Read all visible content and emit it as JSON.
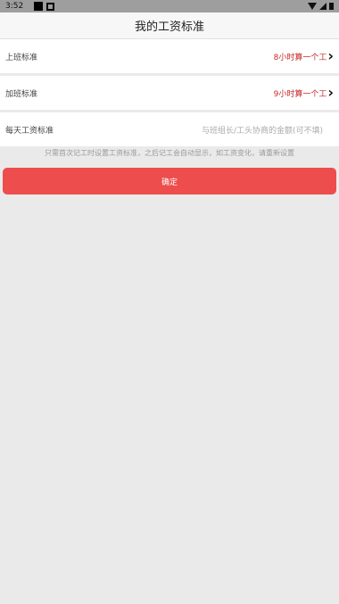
{
  "status_bar": {
    "time": "3:52"
  },
  "header": {
    "title": "我的工资标准"
  },
  "rows": [
    {
      "label": "上班标准",
      "value": "8小时算一个工"
    },
    {
      "label": "加班标准",
      "value": "9小时算一个工"
    }
  ],
  "daily_wage": {
    "label": "每天工资标准",
    "placeholder": "与班组长/工头协商的金额(可不填)"
  },
  "hint": "只需首次记工时设置工资标准，之后记工会自动显示，如工资变化，请重新设置",
  "confirm_button": "确定",
  "colors": {
    "accent": "#ed4d4d",
    "value_red": "#c62828"
  }
}
